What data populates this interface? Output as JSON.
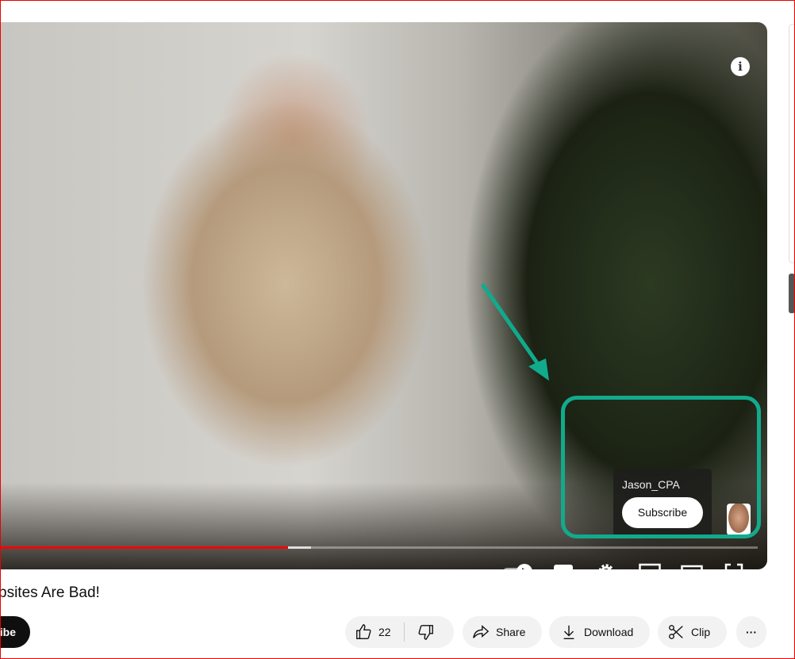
{
  "video": {
    "info_icon": "i",
    "progress_played_fraction": 0.38,
    "progress_buffered_fraction": 0.41
  },
  "end_card": {
    "channel_name": "Jason_CPA",
    "subscribe_label": "Subscribe"
  },
  "annotation_color": "#12aa8c",
  "title": "bsites Are Bad!",
  "actions": {
    "subscribe_label": "ibe",
    "likes": "22",
    "share": "Share",
    "download": "Download",
    "clip": "Clip",
    "more": "···"
  }
}
